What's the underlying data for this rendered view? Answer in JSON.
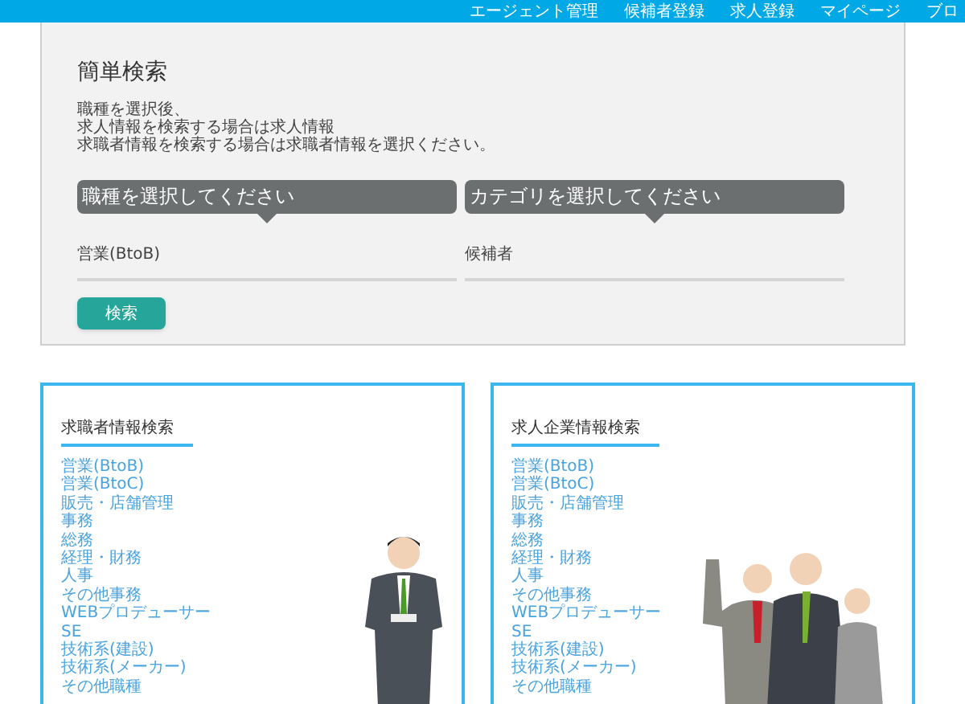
{
  "nav": {
    "items": [
      "エージェント管理",
      "候補者登録",
      "求人登録",
      "マイページ",
      "ブロ"
    ]
  },
  "simple_search": {
    "title": "簡単検索",
    "description_lines": [
      "職種を選択後、",
      "求人情報を検索する場合は求人情報",
      "求職者情報を検索する場合は求職者情報を選択ください。"
    ],
    "selects": [
      {
        "label": "職種を選択してください",
        "value": "営業(BtoB)"
      },
      {
        "label": "カテゴリを選択してください",
        "value": "候補者"
      }
    ],
    "button": "検索"
  },
  "cards": [
    {
      "title": "求職者情報検索",
      "kind": "single",
      "links": [
        "営業(BtoB)",
        "営業(BtoC)",
        "販売・店舗管理",
        "事務",
        "総務",
        "経理・財務",
        "人事",
        "その他事務",
        "WEBプロデューサー",
        "SE",
        "技術系(建設)",
        "技術系(メーカー)",
        "その他職種"
      ]
    },
    {
      "title": "求人企業情報検索",
      "kind": "group",
      "links": [
        "営業(BtoB)",
        "営業(BtoC)",
        "販売・店舗管理",
        "事務",
        "総務",
        "経理・財務",
        "人事",
        "その他事務",
        "WEBプロデューサー",
        "SE",
        "技術系(建設)",
        "技術系(メーカー)",
        "その他職種"
      ]
    }
  ]
}
